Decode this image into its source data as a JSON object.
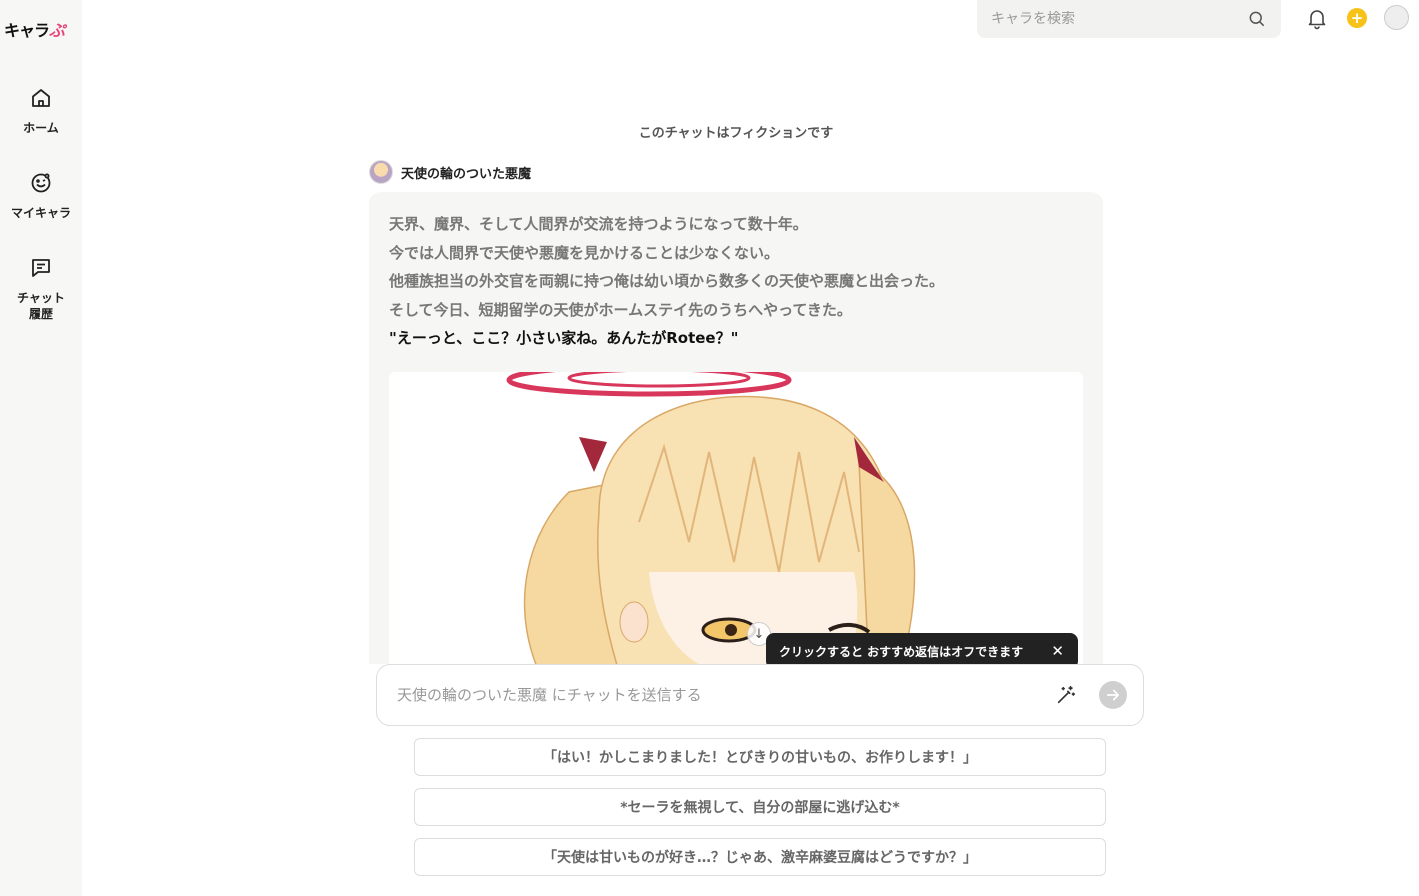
{
  "brand": {
    "logo_main": "キャラ",
    "logo_accent": "ぷ"
  },
  "sidebar": {
    "items": [
      {
        "label": "ホーム",
        "icon": "home-icon"
      },
      {
        "label": "マイキャラ",
        "icon": "smiley-icon"
      },
      {
        "label": "チャット\n履歴",
        "icon": "chat-history-icon"
      }
    ]
  },
  "topbar": {
    "search_placeholder": "キャラを検索",
    "coin_symbol": "+"
  },
  "chat": {
    "fiction_note": "このチャットはフィクションです",
    "character_name": "天使の輪のついた悪魔",
    "message_lines": [
      "天界、魔界、そして人間界が交流を持つようになって数十年。",
      "今では人間界で天使や悪魔を見かけることは少なくない。",
      "他種族担当の外交官を両親に持つ俺は幼い頃から数多くの天使や悪魔と出会った。",
      "そして今日、短期留学の天使がホームステイ先のうちへやってきた。"
    ],
    "quote_line": "\"えーっと、ここ？小さい家ね。あんたがRotee？\"",
    "scroll_glyph": "↓"
  },
  "tooltip": {
    "text": "クリックすると おすすめ返信はオフできます",
    "close_glyph": "✕"
  },
  "input": {
    "placeholder": "天使の輪のついた悪魔 にチャットを送信する"
  },
  "suggestions": [
    "「はい！かしこまりました！とびきりの甘いもの、お作りします！」",
    "*セーラを無視して、自分の部屋に逃げ込む*",
    "「天使は甘いものが好き…？じゃあ、激辛麻婆豆腐はどうですか？」"
  ],
  "colors": {
    "sidebar_bg": "#f7f7f5",
    "bubble_bg": "#f6f6f4",
    "coin": "#f7c21a",
    "halo": "#d8365a",
    "hair": "#f6d9a0"
  }
}
